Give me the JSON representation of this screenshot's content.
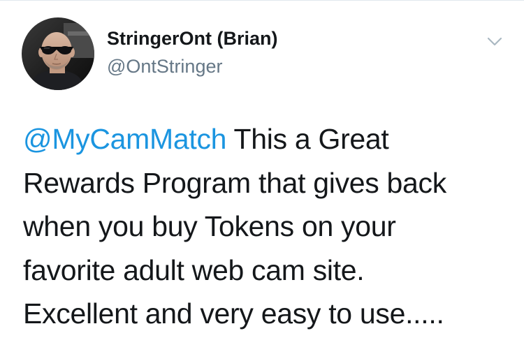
{
  "tweet": {
    "author": {
      "display_name": "StringerOnt (Brian)",
      "handle": "@OntStringer",
      "avatar_icon": "profile-photo"
    },
    "caret_icon": "chevron-down-icon",
    "mention": "@MyCamMatch",
    "text_lines": [
      " This a Great",
      "Rewards Program that gives back",
      "when you buy Tokens on your",
      "favorite adult web cam site.",
      "Excellent and very easy to use....."
    ]
  },
  "colors": {
    "text": "#14171a",
    "secondary": "#657786",
    "link": "#1b95e0",
    "divider": "#e1e8ed"
  }
}
